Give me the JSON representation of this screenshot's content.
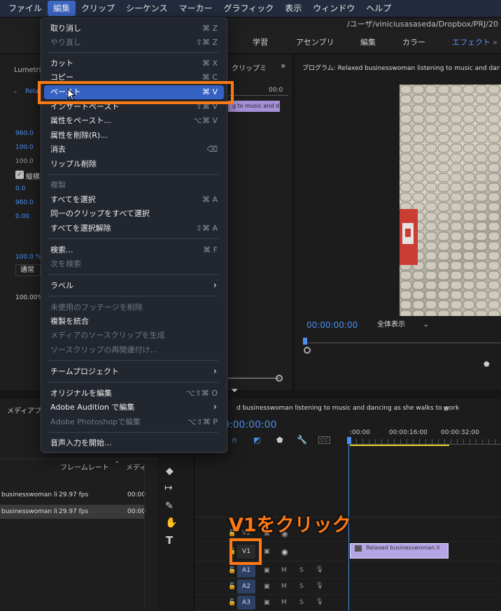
{
  "menubar": {
    "items": [
      "ファイル",
      "編集",
      "クリップ",
      "シーケンス",
      "マーカー",
      "グラフィック",
      "表示",
      "ウィンドウ",
      "ヘルプ"
    ],
    "active_index": 1
  },
  "path": "/ユーザ/viniciusasaseda/Dropbox/PRJ/20",
  "workspaces": {
    "items": [
      "学習",
      "アセンブリ",
      "編集",
      "カラー",
      "エフェクト"
    ],
    "active": "エフェクト"
  },
  "effects": {
    "tab": "Lumetri ス",
    "clip_label": "Relax",
    "values": [
      "960.0",
      "100.0",
      "100.0",
      "0.0",
      "960.0",
      "0.00"
    ],
    "checkbox_label": "縦横",
    "opacity": "100.0 %",
    "blend": "通常",
    "speed": "100.00%"
  },
  "clip_panel": {
    "tab": "クリップミ",
    "time": "00:0",
    "clip_text": "g to music and d"
  },
  "program": {
    "title": "プログラム: Relaxed businesswoman listening to music and dancing",
    "timecode": "00:00:00:00",
    "fit": "全体表示"
  },
  "media": {
    "tab": "メディアブ",
    "col_framerate": "フレームレート",
    "col_media": "メディ",
    "rows": [
      {
        "name": "businesswoman li",
        "fps": "29.97 fps",
        "start": "00:00"
      },
      {
        "name": "businesswoman li",
        "fps": "29.97 fps",
        "start": "00:00"
      }
    ]
  },
  "timeline": {
    "title": "d businesswoman listening to music and dancing as she walks to work",
    "timecode": "0:00:00:00",
    "ruler": [
      ":00:00",
      "00:00:16:00",
      "00:00:32:00"
    ],
    "clip": "Relaxed businesswoman li",
    "tracks": [
      "V2",
      "V1",
      "A1",
      "A2",
      "A3"
    ],
    "m": "M",
    "s": "S"
  },
  "menu": {
    "undo": "取り消し",
    "undo_sc": "⌘ Z",
    "redo": "やり直し",
    "redo_sc": "⇧⌘ Z",
    "cut": "カット",
    "cut_sc": "⌘ X",
    "copy": "コピー",
    "copy_sc": "⌘ C",
    "paste": "ペースト",
    "paste_sc": "⌘ V",
    "paste_insert": "インサートペースト",
    "paste_insert_sc": "⇧⌘ V",
    "paste_attr": "属性をペースト...",
    "paste_attr_sc": "⌥⌘ V",
    "remove_attr": "属性を削除(R)...",
    "clear": "消去",
    "clear_sc": "⌫",
    "ripple": "リップル削除",
    "duplicate": "複製",
    "select_all": "すべてを選択",
    "select_all_sc": "⌘ A",
    "select_same": "同一のクリップをすべて選択",
    "deselect": "すべてを選択解除",
    "deselect_sc": "⇧⌘ A",
    "find": "検索...",
    "find_sc": "⌘ F",
    "find_next": "次を検索",
    "label": "ラベル",
    "remove_unused": "未使用のフッテージを削除",
    "consolidate": "複製を統合",
    "gen_source": "メディアのソースクリップを生成",
    "relink_source": "ソースクリップの再関連付け...",
    "team": "チームプロジェクト",
    "edit_original": "オリジナルを編集",
    "edit_original_sc": "⌥⇧⌘ O",
    "edit_audition": "Adobe Audition で編集",
    "edit_photoshop": "Adobe Photoshopで編集",
    "edit_photoshop_sc": "⌥⇧⌘ P",
    "dictation": "音声入力を開始..."
  },
  "annotation": {
    "callout": "V1をクリック",
    "accent": "#ff7a14"
  }
}
